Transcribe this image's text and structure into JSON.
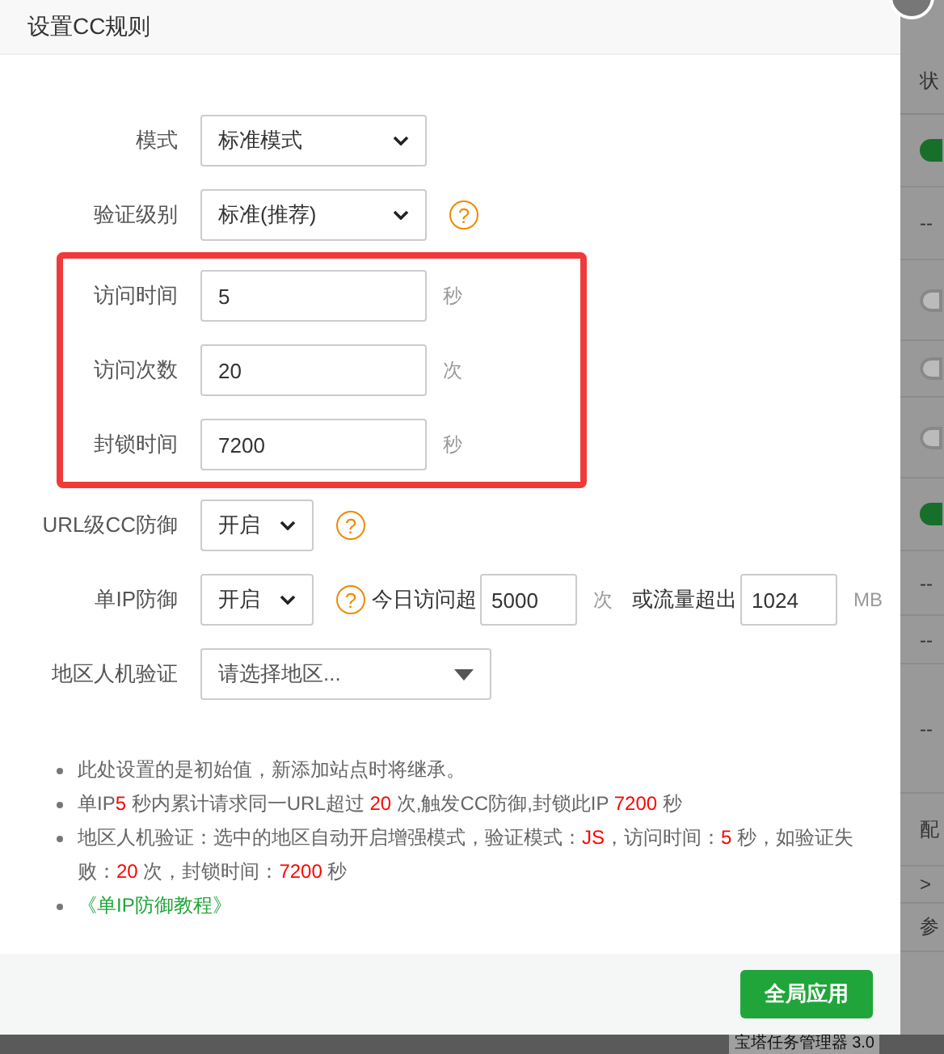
{
  "dialog": {
    "title": "设置CC规则"
  },
  "groups": [
    {
      "highlighted": false,
      "rows": [
        {
          "kind": "select",
          "label": "模式",
          "value": "标准模式"
        },
        {
          "kind": "select",
          "label": "验证级别",
          "value": "标准(推荐)",
          "help": "?"
        }
      ]
    },
    {
      "highlighted": true,
      "rows": [
        {
          "kind": "input",
          "label": "访问时间",
          "value": "5",
          "unit": "秒"
        },
        {
          "kind": "input",
          "label": "访问次数",
          "value": "20",
          "unit": "次"
        },
        {
          "kind": "input",
          "label": "封锁时间",
          "value": "7200",
          "unit": "秒"
        }
      ]
    },
    {
      "highlighted": false,
      "rows": [
        {
          "kind": "small_select",
          "label": "URL级CC防御",
          "value": "开启",
          "help": "?"
        },
        {
          "kind": "small_select",
          "label": "单IP防御",
          "value": "开启",
          "help": "?",
          "limits": [
            {
              "label": "今日访问超",
              "value": "5000",
              "unit": "次"
            },
            {
              "label": "或流量超出",
              "value": "1024",
              "unit": "MB"
            }
          ]
        },
        {
          "kind": "region",
          "label": "地区人机验证",
          "placeholder": "请选择地区..."
        }
      ]
    }
  ],
  "notes": [
    {
      "kind": "text",
      "parts": [
        {
          "text": "此处设置的是初始值，新添加站点时将继承。",
          "emphasis": false
        }
      ]
    },
    {
      "kind": "text",
      "parts": [
        {
          "text": "单IP",
          "emphasis": false
        },
        {
          "text": "5",
          "emphasis": true
        },
        {
          "text": " 秒内累计请求同一URL超过 ",
          "emphasis": false
        },
        {
          "text": "20",
          "emphasis": true
        },
        {
          "text": " 次,触发CC防御,封锁此IP ",
          "emphasis": false
        },
        {
          "text": "7200",
          "emphasis": true
        },
        {
          "text": " 秒",
          "emphasis": false
        }
      ]
    },
    {
      "kind": "text",
      "parts": [
        {
          "text": "地区人机验证：选中的地区自动开启增强模式，验证模式：",
          "emphasis": false
        },
        {
          "text": "JS",
          "emphasis": true
        },
        {
          "text": "，访问时间：",
          "emphasis": false
        },
        {
          "text": "5",
          "emphasis": true
        },
        {
          "text": " 秒，如验证失败：",
          "emphasis": false
        },
        {
          "text": "20",
          "emphasis": true
        },
        {
          "text": " 次，封锁时间：",
          "emphasis": false
        },
        {
          "text": "7200",
          "emphasis": true
        },
        {
          "text": " 秒",
          "emphasis": false
        }
      ]
    },
    {
      "kind": "link",
      "parts": [
        {
          "text": "《单IP防御教程》",
          "emphasis": false
        }
      ]
    }
  ],
  "buttons": [
    "全局应用"
  ],
  "background_page": {
    "header": "状",
    "rows": [
      {
        "kind": "toggle",
        "on": true
      },
      {
        "kind": "text",
        "text": "--"
      },
      {
        "kind": "toggle",
        "on": false
      },
      {
        "kind": "toggle",
        "on": false
      },
      {
        "kind": "toggle",
        "on": false
      },
      {
        "kind": "toggle",
        "on": true
      },
      {
        "kind": "text",
        "text": "--"
      },
      {
        "kind": "text",
        "text": "--"
      },
      {
        "kind": "text",
        "text": "--"
      },
      {
        "kind": "text",
        "text": "配"
      },
      {
        "kind": "text",
        "text": ">"
      },
      {
        "kind": "text",
        "text": "参"
      }
    ],
    "footer": "宝塔任务管理器 3.0"
  }
}
